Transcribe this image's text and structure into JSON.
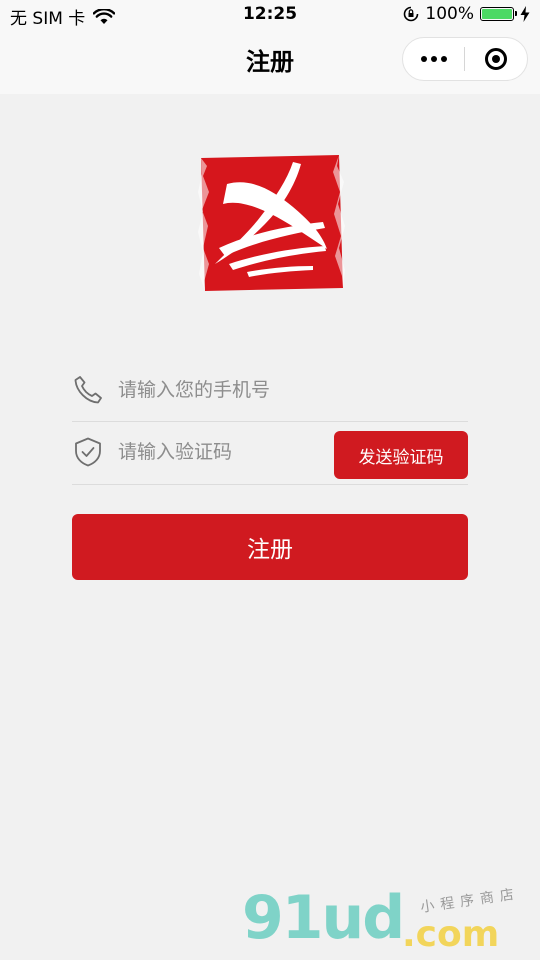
{
  "status_bar": {
    "carrier": "无 SIM 卡",
    "time": "12:25",
    "battery": "100%",
    "battery_level": 1.0
  },
  "nav": {
    "title": "注册"
  },
  "form": {
    "phone_placeholder": "请输入您的手机号",
    "code_placeholder": "请输入验证码",
    "send_code_label": "发送验证码",
    "register_label": "注册"
  },
  "watermark": {
    "main": "91ud",
    "suffix": ".com",
    "tagline": "小程序商店"
  },
  "colors": {
    "accent": "#d01a20",
    "background": "#f1f1f1"
  },
  "icons": {
    "phone": "phone-icon",
    "shield": "shield-check-icon",
    "more": "more-dots-icon",
    "close": "target-circle-icon",
    "wifi": "wifi-icon",
    "lock_rotation": "rotation-lock-icon",
    "charging": "bolt-icon"
  }
}
